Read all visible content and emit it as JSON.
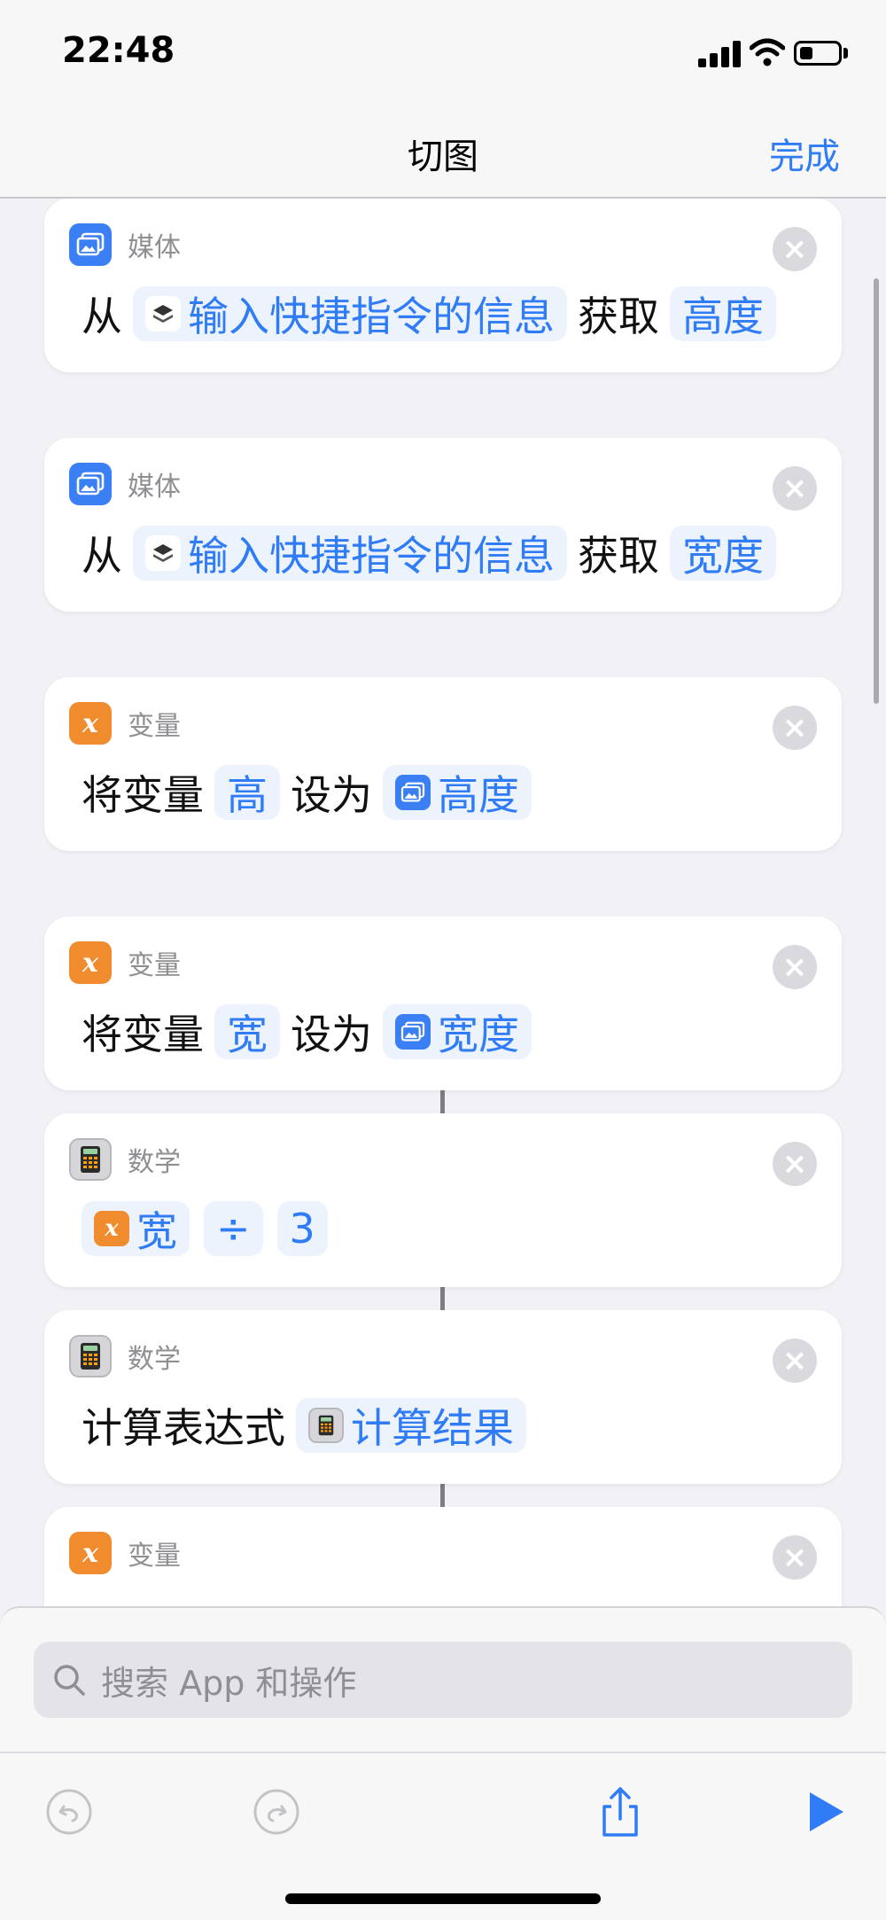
{
  "status_bar": {
    "time": "22:48"
  },
  "nav": {
    "title": "切图",
    "done_label": "完成"
  },
  "icons": {
    "media": "photo-icon",
    "variable": "variable-x-icon",
    "math": "calculator-icon",
    "shortcut_input": "shortcut-layers-icon",
    "close": "close-icon",
    "search": "search-icon",
    "undo": "undo-icon",
    "redo": "redo-icon",
    "share": "share-icon",
    "run": "play-icon"
  },
  "colors": {
    "accent": "#2f7cf6",
    "media": "#3b7ff5",
    "variable": "#f08c2e",
    "math": "#d6d6da"
  },
  "actions": [
    {
      "category": "媒体",
      "body": {
        "from": "从",
        "input_token": "输入快捷指令的信息",
        "get": "获取",
        "property_token": "高度"
      }
    },
    {
      "category": "媒体",
      "body": {
        "from": "从",
        "input_token": "输入快捷指令的信息",
        "get": "获取",
        "property_token": "宽度"
      }
    },
    {
      "category": "变量",
      "body": {
        "set_var": "将变量",
        "var_token": "高",
        "set_to": "设为",
        "value_token": "高度"
      }
    },
    {
      "category": "变量",
      "body": {
        "set_var": "将变量",
        "var_token": "宽",
        "set_to": "设为",
        "value_token": "宽度"
      }
    },
    {
      "category": "数学",
      "body": {
        "operand_token": "宽",
        "operator_token": "÷",
        "number_token": "3"
      }
    },
    {
      "category": "数学",
      "body": {
        "label": "计算表达式",
        "result_token": "计算结果"
      }
    },
    {
      "category": "变量"
    }
  ],
  "search": {
    "placeholder": "搜索 App 和操作"
  }
}
